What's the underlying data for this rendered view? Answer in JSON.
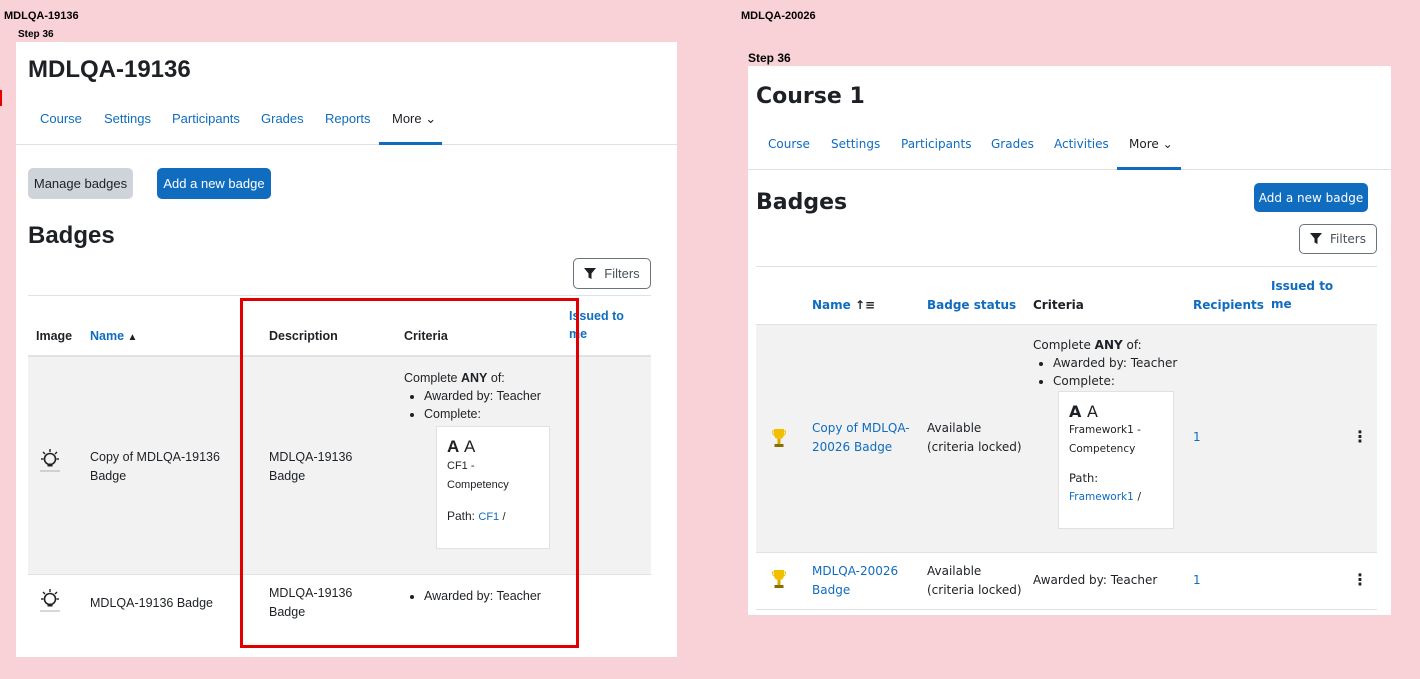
{
  "left": {
    "top_label": "MDLQA-19136",
    "step_label": "Step 36",
    "course_title": "MDLQA-19136",
    "nav": [
      "Course",
      "Settings",
      "Participants",
      "Grades",
      "Reports",
      "More ⌄"
    ],
    "manage_badges": "Manage badges",
    "add_badge": "Add a new badge",
    "heading": "Badges",
    "filters": "Filters",
    "columns": {
      "image": "Image",
      "name": "Name",
      "description": "Description",
      "criteria": "Criteria",
      "issued": "Issued to me"
    },
    "rows": [
      {
        "name": "Copy of MDLQA-19136 Badge",
        "description": "MDLQA-19136 Badge",
        "criteria_intro_pre": "Complete",
        "criteria_intro_bold": "ANY",
        "criteria_intro_post": "of:",
        "criteria_items": [
          "Awarded by: Teacher",
          "Complete:"
        ],
        "competency_letters_bold": "A",
        "competency_letters": "A",
        "competency_name": "CF1 - Competency",
        "path_label": "Path:",
        "path_link": "CF1",
        "path_sep": "/"
      },
      {
        "name": "MDLQA-19136 Badge",
        "description": "MDLQA-19136 Badge",
        "criteria_items": [
          "Awarded by: Teacher"
        ]
      }
    ]
  },
  "right": {
    "top_label": "MDLQA-20026",
    "step_label": "Step 36",
    "course_title": "Course 1",
    "nav": [
      "Course",
      "Settings",
      "Participants",
      "Grades",
      "Activities",
      "More ⌄"
    ],
    "heading": "Badges",
    "add_badge": "Add a new badge",
    "filters": "Filters",
    "columns": {
      "name": "Name",
      "status": "Badge status",
      "criteria": "Criteria",
      "recipients": "Recipients",
      "issued": "Issued to me"
    },
    "rows": [
      {
        "name": "Copy of MDLQA-20026 Badge",
        "status": "Available (criteria locked)",
        "criteria_intro_pre": "Complete",
        "criteria_intro_bold": "ANY",
        "criteria_intro_post": "of:",
        "criteria_items": [
          "Awarded by: Teacher",
          "Complete:"
        ],
        "competency_letters_bold": "A",
        "competency_letters": "A",
        "competency_name": "Framework1 - Competency",
        "path_label": "Path:",
        "path_link": "Framework1",
        "path_sep": "/",
        "recipients": "1"
      },
      {
        "name": "MDLQA-20026 Badge",
        "status": "Available (criteria locked)",
        "criteria_text": "Awarded by: Teacher",
        "recipients": "1"
      }
    ]
  },
  "colors": {
    "page_bg": "#f8d2d6",
    "accent": "#0f6cbf",
    "highlight": "#e00000"
  }
}
